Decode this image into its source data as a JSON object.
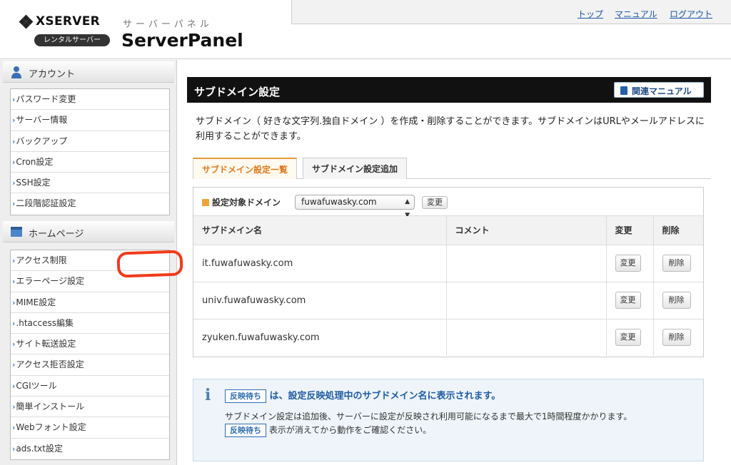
{
  "header": {
    "logo_text": "XSERVER",
    "logo_badge": "レンタルサーバー",
    "panel_kana": "サーバーパネル",
    "panel_title": "ServerPanel",
    "nav": [
      "トップ",
      "マニュアル",
      "ログアウト"
    ]
  },
  "sidebar": {
    "account_heading": "アカウント",
    "account_items": [
      "パスワード変更",
      "サーバー情報",
      "バックアップ",
      "Cron設定",
      "SSH設定",
      "二段階認証設定"
    ],
    "homepage_heading": "ホームページ",
    "homepage_items": [
      "アクセス制限",
      "エラーページ設定",
      "MIME設定",
      ".htaccess編集",
      "サイト転送設定",
      "アクセス拒否設定",
      "CGIツール",
      "簡単インストール",
      "Webフォント設定",
      "ads.txt設定"
    ]
  },
  "main": {
    "section_title": "サブドメイン設定",
    "manual_button": "関連マニュアル",
    "description": "サブドメイン（ 好きな文字列.独自ドメイン ）を作成・削除することができます。サブドメインはURLやメールアドレスに利用することができます。",
    "tabs": [
      "サブドメイン設定一覧",
      "サブドメイン設定追加"
    ],
    "domain_label": "設定対象ドメイン",
    "domain_selected": "fuwafuwasky.com",
    "domain_change_button": "変更",
    "table": {
      "headers": [
        "サブドメイン名",
        "コメント",
        "変更",
        "削除"
      ],
      "rows": [
        {
          "name": "it.fuwafuwasky.com",
          "comment": "",
          "change": "変更",
          "delete": "削除"
        },
        {
          "name": "univ.fuwafuwasky.com",
          "comment": "",
          "change": "変更",
          "delete": "削除"
        },
        {
          "name": "zyuken.fuwafuwasky.com",
          "comment": "",
          "change": "変更",
          "delete": "削除"
        }
      ]
    },
    "info": {
      "badge": "反映待ち",
      "headline": "は、設定反映処理中のサブドメイン名に表示されます。",
      "body": "サブドメイン設定は追加後、サーバーに設定が反映され利用可能になるまで最大で1時間程度かかります。",
      "badge2": "反映待ち",
      "body2": "表示が消えてから動作をご確認ください。"
    }
  },
  "colors": {
    "link": "#1a55a8",
    "active_tab": "#e07a1f",
    "marker": "#f03b1a",
    "info_bg": "#eef4fa"
  }
}
